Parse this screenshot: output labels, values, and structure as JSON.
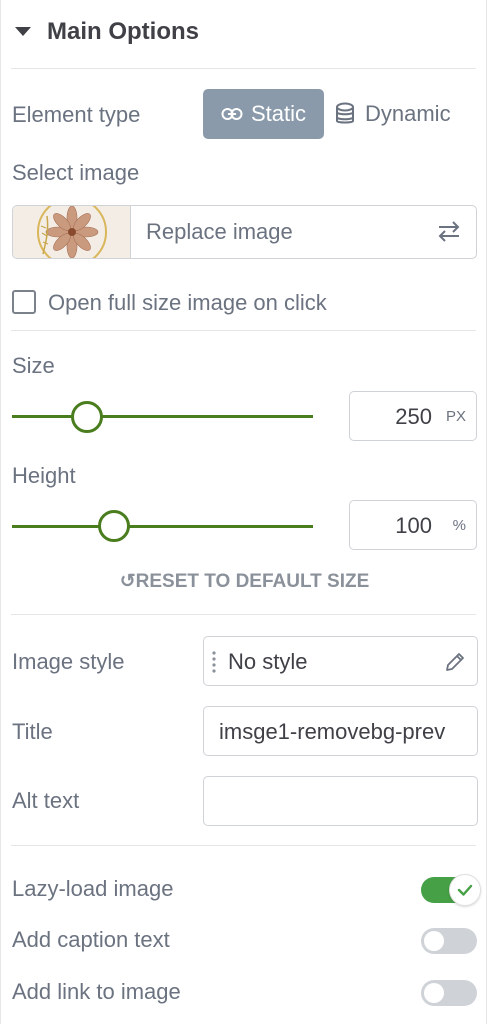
{
  "section": {
    "title": "Main Options"
  },
  "element_type": {
    "label": "Element type",
    "options": [
      "Static",
      "Dynamic"
    ],
    "selected": "Static"
  },
  "select_image": {
    "label": "Select image",
    "replace_label": "Replace image"
  },
  "open_full_size": {
    "label": "Open full size image on click",
    "checked": false
  },
  "size": {
    "label": "Size",
    "value": "250",
    "unit": "PX",
    "level": 0.25
  },
  "height": {
    "label": "Height",
    "value": "100",
    "unit": "%",
    "level": 0.34
  },
  "reset": {
    "label": "RESET TO DEFAULT SIZE"
  },
  "image_style": {
    "label": "Image style",
    "value": "No style"
  },
  "title": {
    "label": "Title",
    "value": "imsge1-removebg-prev"
  },
  "alt_text": {
    "label": "Alt text",
    "value": ""
  },
  "toggles": [
    {
      "label": "Lazy-load image",
      "on": true
    },
    {
      "label": "Add caption text",
      "on": false
    },
    {
      "label": "Add link to image",
      "on": false
    }
  ],
  "colors": {
    "accent": "#4a7d1e",
    "toggle_on": "#46a046",
    "segment_active": "#8a9aab"
  }
}
